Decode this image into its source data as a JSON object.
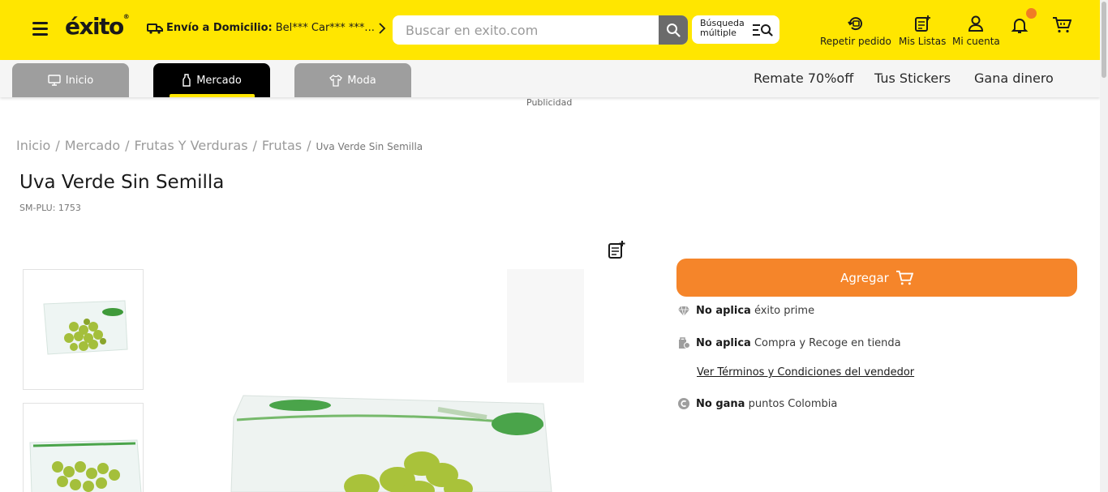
{
  "header": {
    "logo_text": "éxito",
    "logo_reg": "®",
    "delivery_label": "Envío a Domicilio:",
    "delivery_address": "Bel*** Car*** ***...",
    "search_placeholder": "Buscar en exito.com",
    "multi_search_line1": "Búsqueda",
    "multi_search_line2": "múltiple",
    "actions": {
      "repeat_order": "Repetir pedido",
      "my_lists": "Mis Listas",
      "my_account": "Mi cuenta"
    },
    "brand_color": "#ffe600",
    "notification_dot_color": "#f07c25"
  },
  "tabs": [
    {
      "label": "Inicio",
      "active": false
    },
    {
      "label": "Mercado",
      "active": true
    },
    {
      "label": "Moda",
      "active": false
    }
  ],
  "promos": [
    "Remate 70%off",
    "Tus Stickers",
    "Gana dinero"
  ],
  "ad_label": "Publicidad",
  "breadcrumb": [
    "Inicio",
    "Mercado",
    "Frutas Y Verduras",
    "Frutas",
    "Uva Verde Sin Semilla"
  ],
  "product": {
    "title": "Uva Verde Sin Semilla",
    "sku": "SM-PLU: 1753",
    "add_button": "Agregar",
    "add_button_color": "#f5852a",
    "prime_bold": "No aplica",
    "prime_text": "éxito prime",
    "pickup_bold": "No aplica",
    "pickup_text": "Compra y Recoge en tienda",
    "terms_link": "Ver Términos y Condiciones del vendedor",
    "points_bold": "No gana",
    "points_text": "puntos Colombia"
  }
}
